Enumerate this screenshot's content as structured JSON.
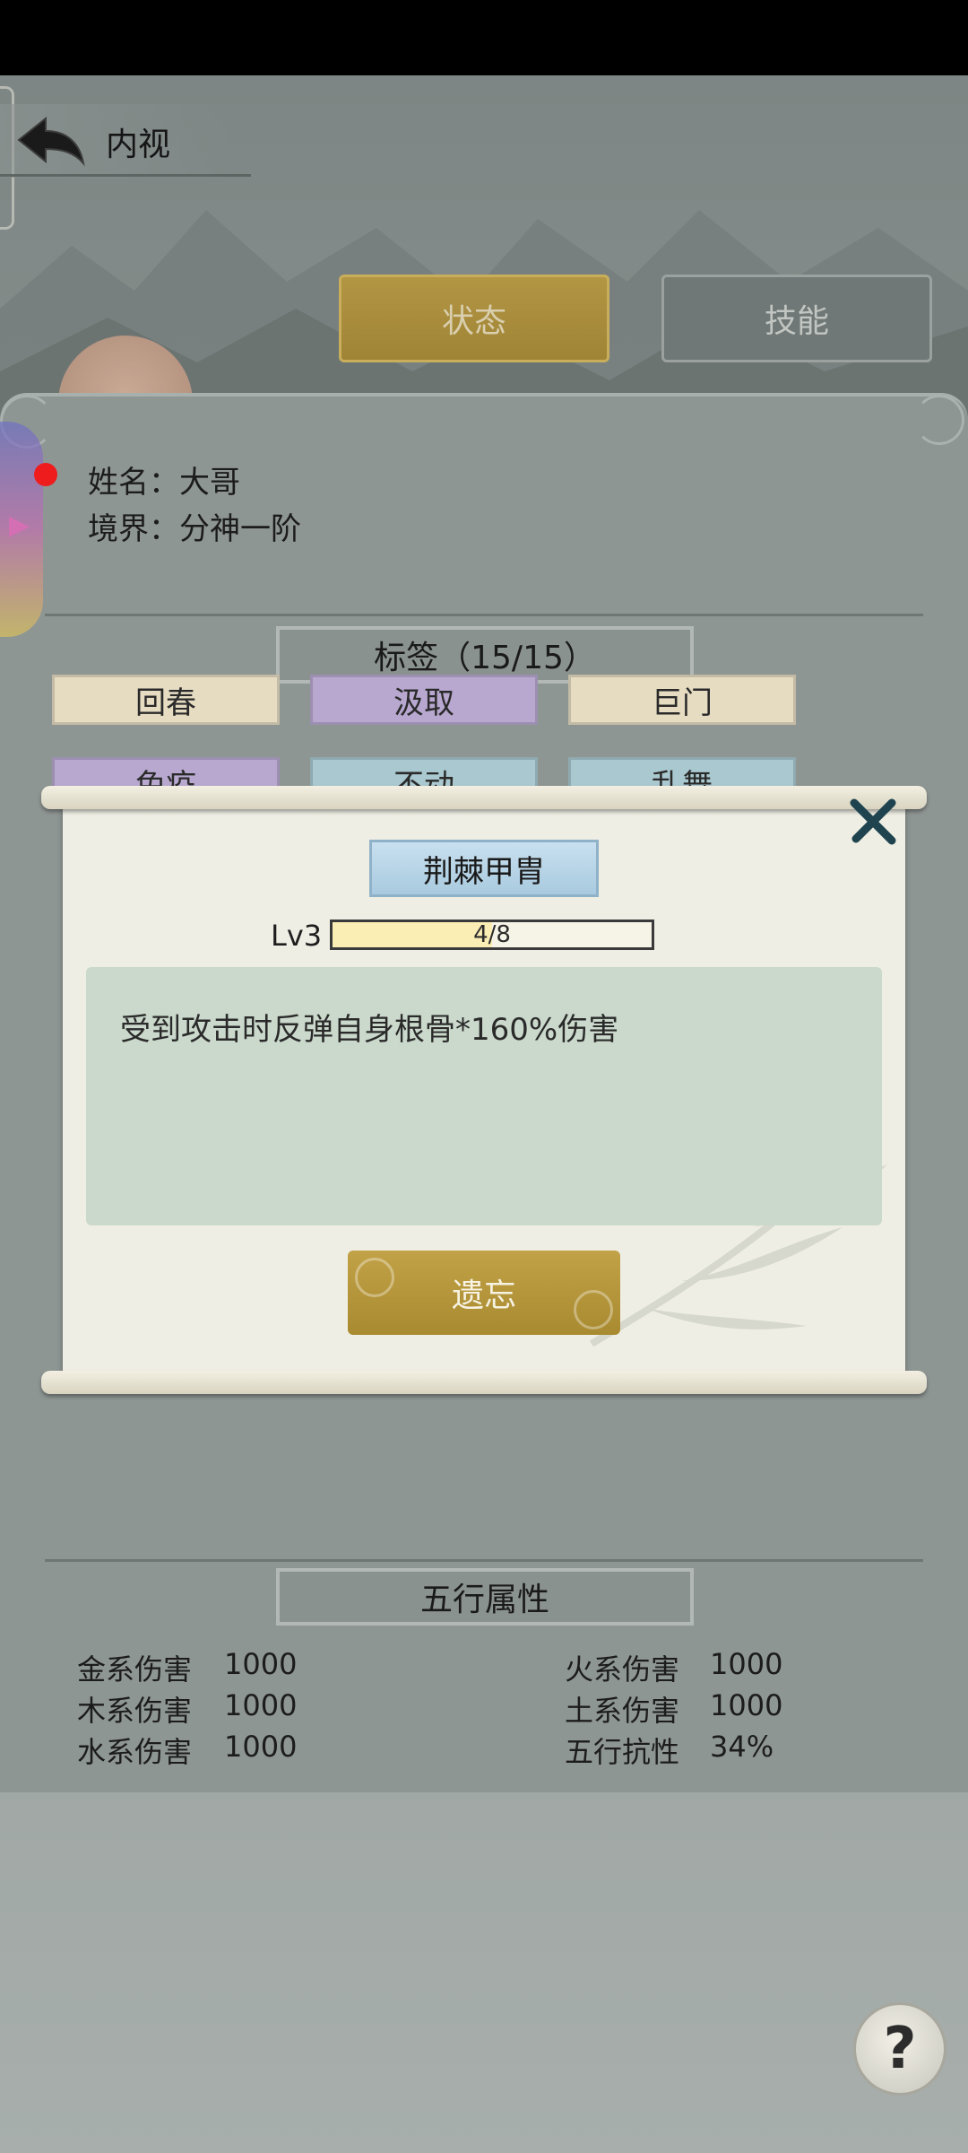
{
  "header": {
    "title": "内视"
  },
  "tabs": [
    {
      "label": "状态",
      "active": true
    },
    {
      "label": "技能",
      "active": false
    }
  ],
  "character": {
    "name_line": "姓名：大哥",
    "realm_line": "境界：分神一阶"
  },
  "tags_section": {
    "title": "标签（15/15）",
    "tags": [
      {
        "label": "回春",
        "color": "#e6dcc2"
      },
      {
        "label": "汲取",
        "color": "#b8a8d0"
      },
      {
        "label": "巨门",
        "color": "#e6dcc2"
      },
      {
        "label": "免疫",
        "color": "#b8a8d0"
      },
      {
        "label": "不动",
        "color": "#a9c8cf"
      },
      {
        "label": "乱舞",
        "color": "#a9c8cf"
      }
    ]
  },
  "dialog": {
    "skill_name": "荆棘甲胄",
    "level_label": "Lv3",
    "progress_text": "4/8",
    "progress_fraction": 0.5,
    "description": "受到攻击时反弹自身根骨*160%伤害",
    "forget_label": "遗忘"
  },
  "elements_section": {
    "title": "五行属性",
    "left": [
      {
        "label": "金系伤害",
        "value": "1000"
      },
      {
        "label": "木系伤害",
        "value": "1000"
      },
      {
        "label": "水系伤害",
        "value": "1000"
      }
    ],
    "right": [
      {
        "label": "火系伤害",
        "value": "1000"
      },
      {
        "label": "土系伤害",
        "value": "1000"
      },
      {
        "label": "五行抗性",
        "value": "34%"
      }
    ]
  },
  "help": {
    "glyph": "?"
  },
  "colors": {
    "accent_gold": "#b39644",
    "dialog_bg": "#efeee4",
    "desc_bg": "#cbd9cc",
    "red_dot": "#ee1c1c"
  }
}
